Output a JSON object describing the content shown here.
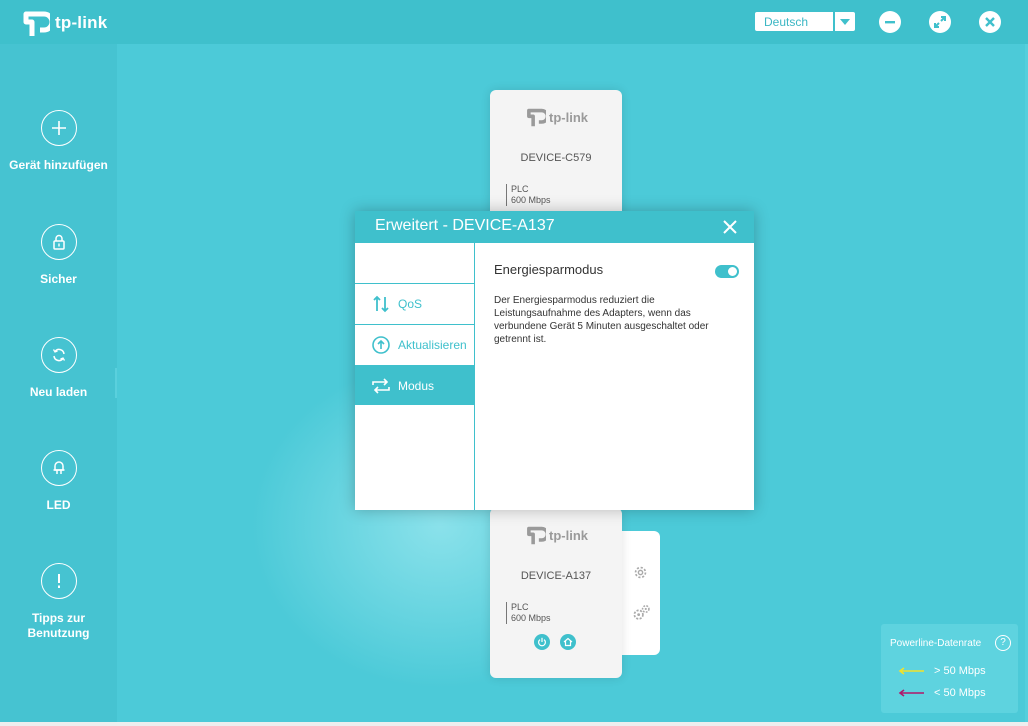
{
  "app": {
    "brand": "tp-link"
  },
  "header": {
    "language": "Deutsch"
  },
  "sidebar": {
    "items": [
      {
        "label": "Gerät hinzufügen",
        "icon": "plus-icon"
      },
      {
        "label": "Sicher",
        "icon": "lock-icon"
      },
      {
        "label": "Neu laden",
        "icon": "refresh-icon"
      },
      {
        "label": "LED",
        "icon": "led-icon"
      },
      {
        "label": "Tipps zur Benutzung",
        "icon": "exclamation-icon"
      }
    ]
  },
  "devices": [
    {
      "brand": "tp-link",
      "name": "DEVICE-C579",
      "spec_type": "PLC",
      "spec_rate": "600 Mbps"
    },
    {
      "brand": "tp-link",
      "name": "DEVICE-A137",
      "spec_type": "PLC",
      "spec_rate": "600 Mbps"
    }
  ],
  "dialog": {
    "title": "Erweitert - DEVICE-A137",
    "nav": [
      {
        "label": "QoS",
        "icon": "qos-icon",
        "active": false
      },
      {
        "label": "Aktualisieren",
        "icon": "upload-icon",
        "active": false
      },
      {
        "label": "Modus",
        "icon": "mode-icon",
        "active": true
      }
    ],
    "setting_title": "Energiesparmodus",
    "setting_enabled": true,
    "setting_description": "Der Energiesparmodus reduziert die Leistungsaufnahme des Adapters, wenn das verbundene Gerät 5 Minuten ausgeschaltet oder getrennt ist."
  },
  "legend": {
    "title": "Powerline-Datenrate",
    "help": "?",
    "items": [
      {
        "label": "> 50 Mbps",
        "color": "#f2e22a"
      },
      {
        "label": "< 50 Mbps",
        "color": "#b0186a"
      }
    ]
  },
  "colors": {
    "accent": "#3fc0cc",
    "background": "#4ccad8"
  }
}
